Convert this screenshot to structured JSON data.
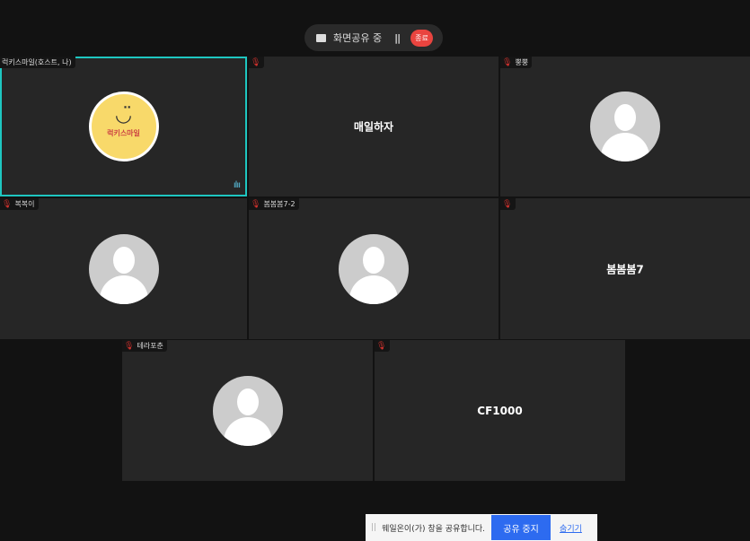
{
  "share_pill": {
    "status": "화면공유 중",
    "pause_icon": "pause-icon",
    "end_label": "종료"
  },
  "tiles": [
    {
      "name": "럭키스마일(호스트, 나)",
      "avatar_text": "럭키스마일",
      "active_speaker": true
    },
    {
      "name": "",
      "center_name": "매일하자",
      "muted": true
    },
    {
      "name": "뿡뿡",
      "muted": true
    },
    {
      "name": "복복이",
      "muted": true
    },
    {
      "name": "봄봄봄7-2",
      "muted": true
    },
    {
      "name": "",
      "center_name": "봄봄봄7",
      "muted": true
    },
    {
      "name": "테라포춘",
      "muted": true
    },
    {
      "name": "",
      "center_name": "CF1000",
      "muted": true
    }
  ],
  "share_bar": {
    "message": "웨일온이(가) 창을 공유합니다.",
    "stop_label": "공유 중지",
    "hide_label": "숨기기"
  },
  "colors": {
    "active_border": "#1ec6c0",
    "end": "#e9443f",
    "stop": "#2d6bf0"
  }
}
